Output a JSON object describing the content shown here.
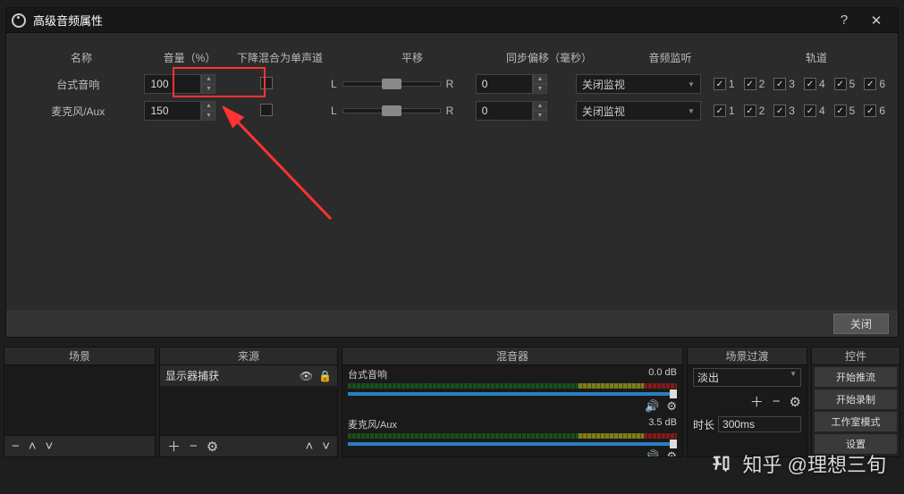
{
  "dialog": {
    "title": "高级音频属性",
    "help": "?",
    "close_x": "✕",
    "headers": {
      "name": "名称",
      "volume": "音量（%）",
      "downmix": "下降混合为单声道",
      "pan": "平移",
      "sync": "同步偏移（毫秒）",
      "monitor": "音频监听",
      "tracks": "轨道"
    },
    "rows": [
      {
        "name": "台式音响",
        "volume": "100",
        "downmix": false,
        "sync": "0",
        "monitor": "关闭监视",
        "tracks": [
          true,
          true,
          true,
          true,
          true,
          true
        ]
      },
      {
        "name": "麦克风/Aux",
        "volume": "150",
        "downmix": false,
        "sync": "0",
        "monitor": "关闭监视",
        "tracks": [
          true,
          true,
          true,
          true,
          true,
          true
        ]
      }
    ],
    "pan_l": "L",
    "pan_r": "R",
    "track_labels": [
      "1",
      "2",
      "3",
      "4",
      "5",
      "6"
    ],
    "close_btn": "关闭"
  },
  "panels": {
    "scenes": "场景",
    "sources": "来源",
    "mixer": "混音器",
    "transitions": "场景过渡",
    "controls": "控件"
  },
  "sources": {
    "item": "显示器捕获"
  },
  "mixer": {
    "ch1": {
      "name": "台式音响",
      "db": "0.0 dB"
    },
    "ch2": {
      "name": "麦克风/Aux",
      "db": "3.5 dB"
    }
  },
  "transitions": {
    "type": "淡出",
    "duration_label": "时长",
    "duration": "300ms"
  },
  "controls": {
    "stream": "开始推流",
    "record": "开始录制",
    "studio": "工作室模式",
    "settings": "设置"
  },
  "watermark": "知乎 @理想三旬",
  "icons": {
    "plus": "＋",
    "minus": "−",
    "up": "˄",
    "down": "˅",
    "gear": "⚙",
    "eye": "👁",
    "lock": "🔒",
    "speaker": "🔊"
  }
}
